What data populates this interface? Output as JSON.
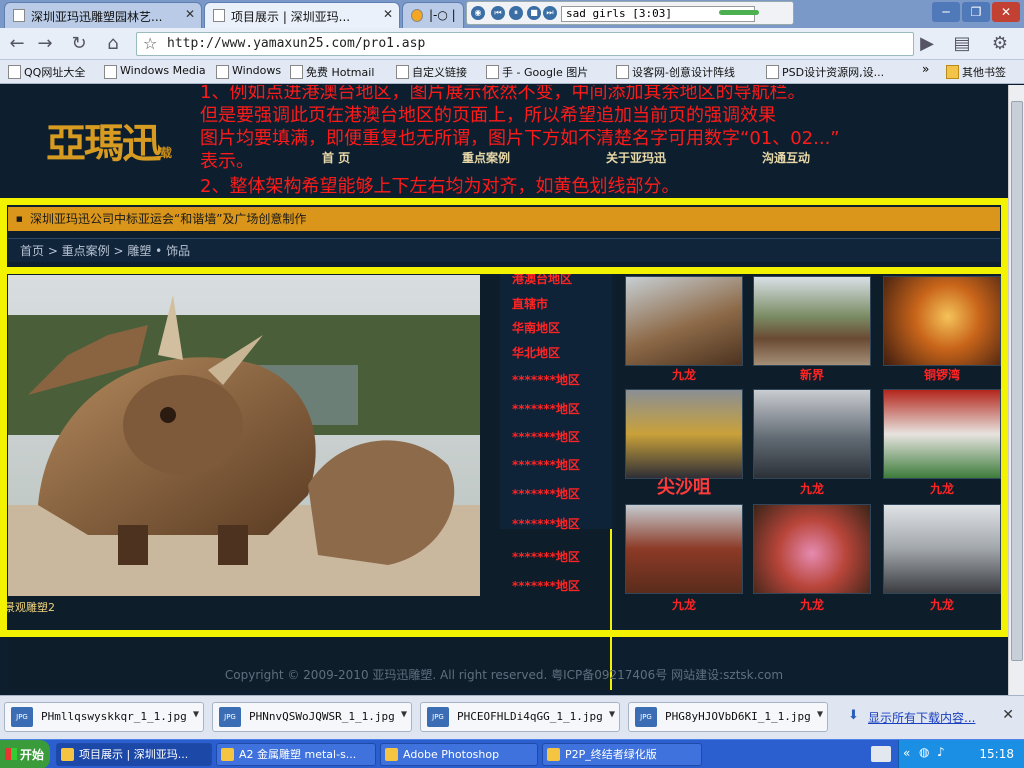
{
  "browser": {
    "tabs": [
      {
        "label": "深圳亚玛迅雕塑园林艺...",
        "active": false
      },
      {
        "label": "项目展示 | 深圳亚玛...",
        "active": true
      },
      {
        "label": "|-○ |",
        "active": false
      }
    ],
    "media_player": {
      "song": "sad girls [3:03]"
    },
    "url": "http://www.yamaxun25.com/pro1.asp",
    "bookmarks": [
      "QQ网址大全",
      "Windows Media",
      "Windows",
      "免费 Hotmail",
      "自定义链接",
      "手 - Google 图片",
      "设客网-创意设计阵线",
      "PSD设计资源网,设...",
      "其他书签"
    ]
  },
  "site": {
    "logo_text": "亞瑪迅",
    "logo_sub": "载",
    "nav": [
      "首 页",
      "重点案例",
      "关于亚玛迅",
      "沟通互动"
    ],
    "annotations": [
      "1、例如点进港澳台地区，图片展示依然不变，中间添加其余地区的导航栏。",
      "但是要强调此页在港澳台地区的页面上，所以希望追加当前页的强调效果",
      "图片均要填满，即便重复也无所谓，图片下方如不清楚名字可用数字“01、02...”",
      "表示。",
      "2、整体架构希望能够上下左右均为对齐，如黄色划线部分。"
    ],
    "ticker": "深圳亚玛迅公司中标亚运会“和谐墙”及广场创意制作",
    "breadcrumb": "首页 > 重点案例 > 雕塑 • 饰品",
    "hero_caption": "景观雕塑2",
    "regions": [
      "港澳台地区",
      "直辖市",
      "华南地区",
      "华北地区",
      "*******地区",
      "*******地区",
      "*******地区",
      "*******地区",
      "*******地区",
      "*******地区",
      "*******地区",
      "*******地区"
    ],
    "thumbs": [
      {
        "label": "九龙",
        "big": false
      },
      {
        "label": "新界",
        "big": false
      },
      {
        "label": "铜锣湾",
        "big": false
      },
      {
        "label": "尖沙咀",
        "big": true
      },
      {
        "label": "九龙",
        "big": false
      },
      {
        "label": "九龙",
        "big": false
      },
      {
        "label": "九龙",
        "big": false
      },
      {
        "label": "九龙",
        "big": false
      },
      {
        "label": "九龙",
        "big": false
      }
    ],
    "copyright": "Copyright © 2009-2010 亚玛迅雕塑. All right reserved. 粤ICP备09217406号 网站建设:sztsk.com"
  },
  "downloads": {
    "items": [
      "PHmllqswyskkqr_1_1.jpg",
      "PHNnvQSWoJQWSR_1_1.jpg",
      "PHCEOFHLDi4qGG_1_1.jpg",
      "PHG8yHJOVbD6KI_1_1.jpg"
    ],
    "file_badge": "JPG",
    "show_all": "显示所有下载内容..."
  },
  "taskbar": {
    "start": "开始",
    "tasks": [
      "项目展示 | 深圳亚玛...",
      "A2 金属雕塑 metal-s...",
      "Adobe Photoshop",
      "P2P_终结者绿化版"
    ],
    "time": "15:18"
  }
}
